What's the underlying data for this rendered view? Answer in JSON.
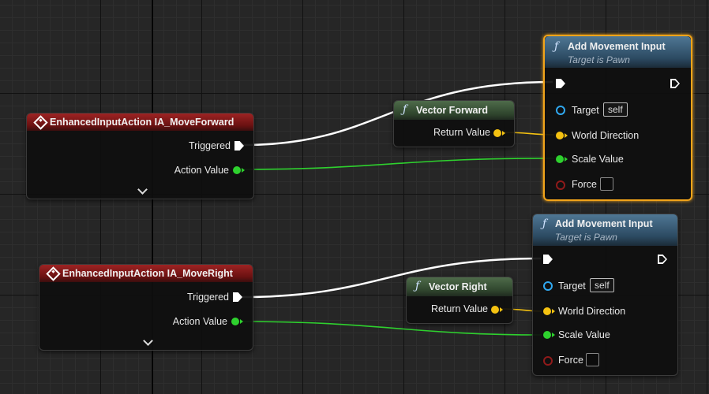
{
  "event_nodes": [
    {
      "title": "EnhancedInputAction IA_MoveForward",
      "pins": [
        "Triggered",
        "Action Value"
      ]
    },
    {
      "title": "EnhancedInputAction IA_MoveRight",
      "pins": [
        "Triggered",
        "Action Value"
      ]
    }
  ],
  "pure_nodes": [
    {
      "title": "Vector Forward",
      "output": "Return Value"
    },
    {
      "title": "Vector Right",
      "output": "Return Value"
    }
  ],
  "function_nodes": [
    {
      "title": "Add Movement Input",
      "subtitle": "Target is Pawn",
      "selected": true,
      "inputs": {
        "target": "Target",
        "target_default": "self",
        "world_direction": "World Direction",
        "scale_value": "Scale Value",
        "force": "Force"
      }
    },
    {
      "title": "Add Movement Input",
      "subtitle": "Target is Pawn",
      "selected": false,
      "inputs": {
        "target": "Target",
        "target_default": "self",
        "world_direction": "World Direction",
        "scale_value": "Scale Value",
        "force": "Force"
      }
    }
  ],
  "icons": {
    "event": "event-diamond-icon",
    "function": "function-f-icon",
    "exec": "exec-pin-icon",
    "expand": "chevron-down-icon"
  },
  "colors": {
    "exec_wire": "#ffffff",
    "float_wire": "#2ed12e",
    "vector_wire": "#f5c211",
    "selection": "#f2a41a",
    "event_header": "#9d2323",
    "function_header": "#4f7794",
    "pure_header": "#4e6b4a"
  }
}
